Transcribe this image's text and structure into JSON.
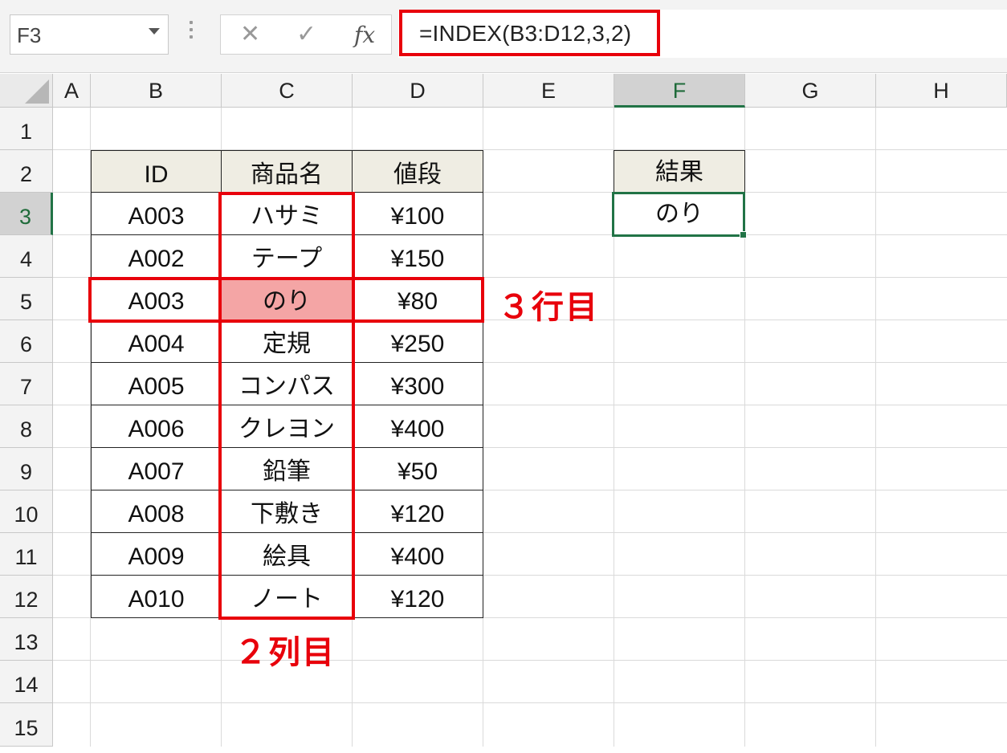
{
  "formula_bar": {
    "name_box": "F3",
    "cancel_icon": "✕",
    "enter_icon": "✓",
    "fx_label": "fx",
    "formula": "=INDEX(B3:D12,3,2)"
  },
  "columns": [
    "A",
    "B",
    "C",
    "D",
    "E",
    "F",
    "G",
    "H"
  ],
  "selected_column": "F",
  "rows": [
    "1",
    "2",
    "3",
    "4",
    "5",
    "6",
    "7",
    "8",
    "9",
    "10",
    "11",
    "12",
    "13",
    "14",
    "15"
  ],
  "selected_row": "3",
  "table": {
    "headers": [
      "ID",
      "商品名",
      "値段"
    ],
    "rows": [
      [
        "A003",
        "ハサミ",
        "¥100"
      ],
      [
        "A002",
        "テープ",
        "¥150"
      ],
      [
        "A003",
        "のり",
        "¥80"
      ],
      [
        "A004",
        "定規",
        "¥250"
      ],
      [
        "A005",
        "コンパス",
        "¥300"
      ],
      [
        "A006",
        "クレヨン",
        "¥400"
      ],
      [
        "A007",
        "鉛筆",
        "¥50"
      ],
      [
        "A008",
        "下敷き",
        "¥120"
      ],
      [
        "A009",
        "絵具",
        "¥400"
      ],
      [
        "A010",
        "ノート",
        "¥120"
      ]
    ]
  },
  "result": {
    "header": "結果",
    "value": "のり"
  },
  "annotations": {
    "row_label": "３行目",
    "col_label": "２列目"
  },
  "colors": {
    "highlight_red": "#e8000b",
    "accent_green": "#217346",
    "header_fill": "#efede3",
    "pink_fill": "#f4a5a5"
  }
}
